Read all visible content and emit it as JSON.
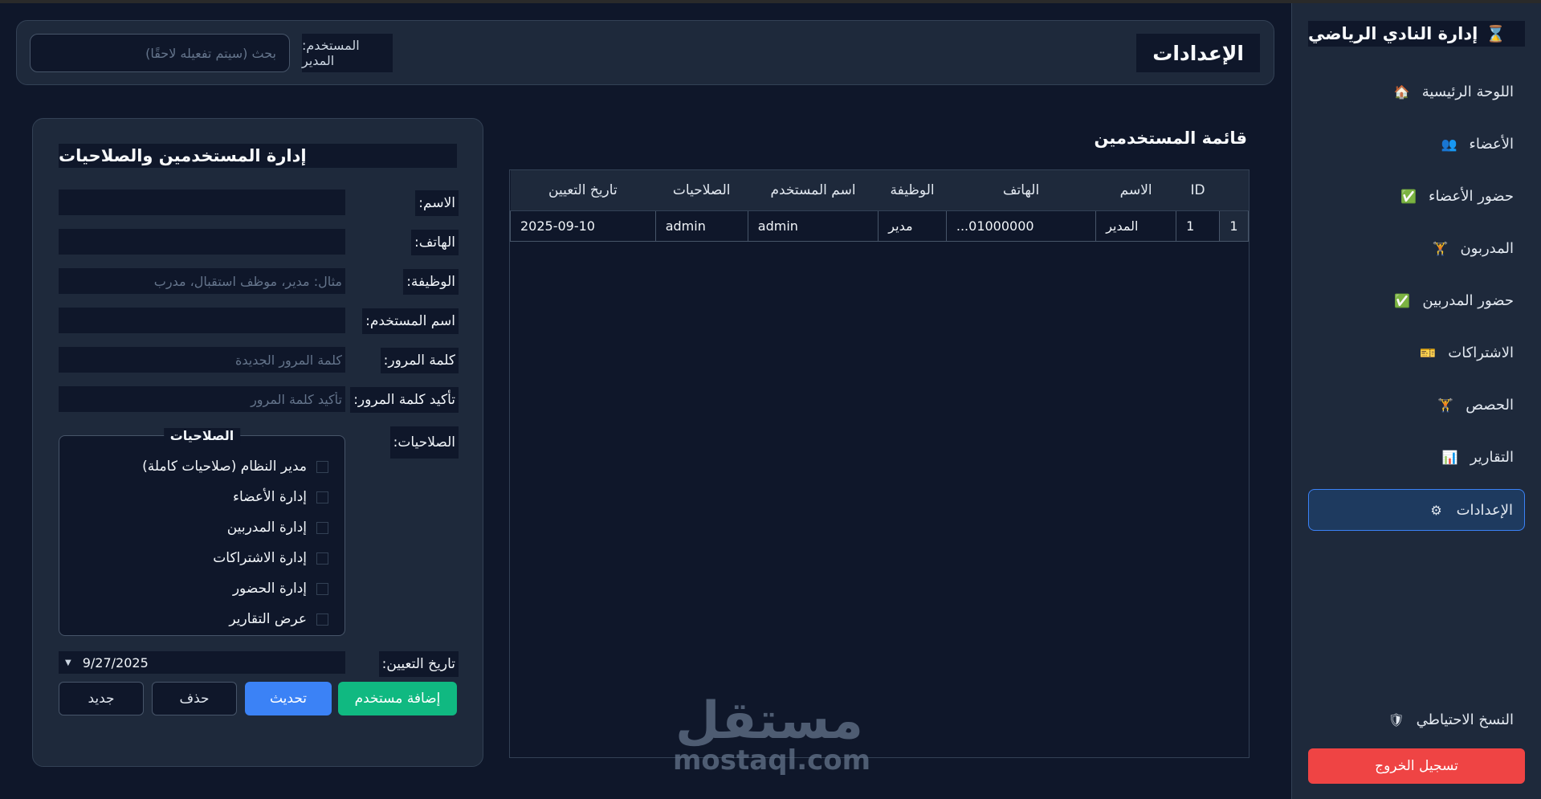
{
  "app": {
    "title": "إدارة النادي الرياضي",
    "brand_icon": "⌛"
  },
  "sidebar": {
    "items": [
      {
        "label": "اللوحة الرئيسية",
        "icon": "🏠"
      },
      {
        "label": "الأعضاء",
        "icon": "👥"
      },
      {
        "label": "حضور الأعضاء",
        "icon": "✅"
      },
      {
        "label": "المدربون",
        "icon": "🏋"
      },
      {
        "label": "حضور المدربين",
        "icon": "✅"
      },
      {
        "label": "الاشتراكات",
        "icon": "🎫"
      },
      {
        "label": "الحصص",
        "icon": "🏋"
      },
      {
        "label": "التقارير",
        "icon": "📊"
      },
      {
        "label": "الإعدادات",
        "icon": "⚙"
      }
    ],
    "backup": {
      "label": "النسخ الاحتياطي",
      "icon": "🛡"
    },
    "logout_label": "تسجيل الخروج"
  },
  "header": {
    "title": "الإعدادات",
    "user_label": "المستخدم: المدير",
    "search_placeholder": "بحث (سيتم تفعيله لاحقًا)"
  },
  "users_list": {
    "title": "قائمة المستخدمين",
    "columns": [
      "ID",
      "الاسم",
      "الهاتف",
      "الوظيفة",
      "اسم المستخدم",
      "الصلاحيات",
      "تاريخ التعيين"
    ],
    "rows": [
      {
        "num": "1",
        "cells": [
          "1",
          "المدير",
          "01000000...",
          "مدير",
          "admin",
          "admin",
          "2025-09-10"
        ]
      }
    ]
  },
  "form": {
    "title": "إدارة المستخدمين والصلاحيات",
    "fields": {
      "name_label": "الاسم:",
      "phone_label": "الهاتف:",
      "job_label": "الوظيفة:",
      "job_placeholder": "مثال: مدير، موظف استقبال، مدرب",
      "username_label": "اسم المستخدم:",
      "password_label": "كلمة المرور:",
      "password_placeholder": "كلمة المرور الجديدة",
      "confirm_label": "تأكيد كلمة المرور:",
      "confirm_placeholder": "تأكيد كلمة المرور",
      "permissions_label": "الصلاحيات:",
      "date_label": "تاريخ التعيين:",
      "date_value": "9/27/2025"
    },
    "permissions": {
      "legend": "الصلاحيات",
      "items": [
        "مدير النظام (صلاحيات كاملة)",
        "إدارة الأعضاء",
        "إدارة المدربين",
        "إدارة الاشتراكات",
        "إدارة الحضور",
        "عرض التقارير"
      ]
    },
    "buttons": {
      "add": "إضافة مستخدم",
      "update": "تحديث",
      "delete": "حذف",
      "new": "جديد"
    }
  },
  "watermark": {
    "arabic": "مستقل",
    "latin": "mostaql.com"
  },
  "colors": {
    "accent": "#3b82f6",
    "success": "#10b981",
    "danger": "#ef4444",
    "background": "#0f172a",
    "panel": "#1e293b"
  }
}
